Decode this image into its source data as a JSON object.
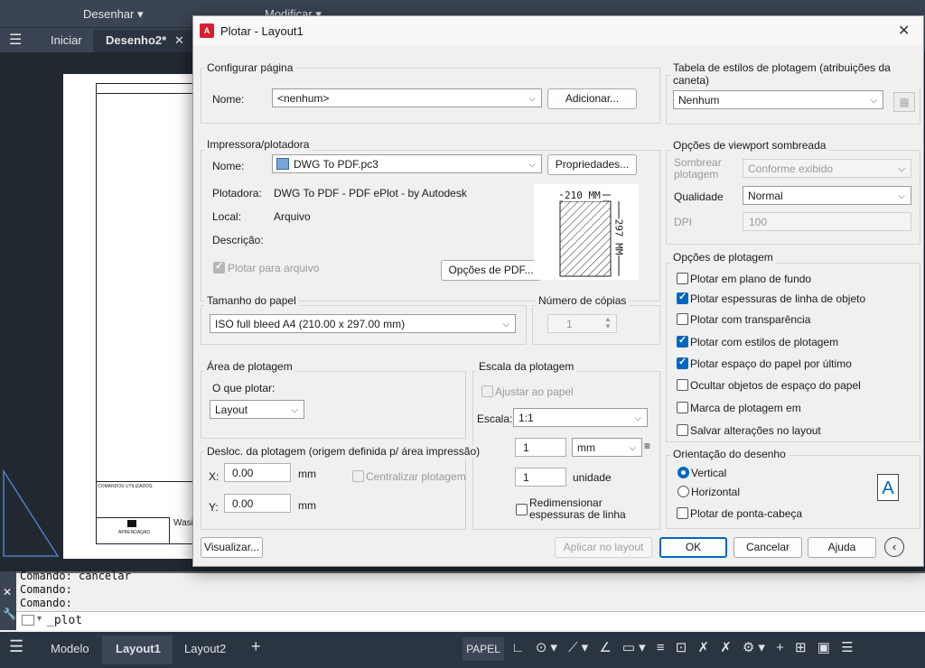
{
  "ribbon": {
    "desenhar": "Desenhar",
    "modificar": "Modificar"
  },
  "doc_tabs": {
    "iniciar": "Iniciar",
    "desenho2": "Desenho2*"
  },
  "dialog": {
    "title": "Plotar - Layout1",
    "page_setup": {
      "group": "Configurar página",
      "name_label": "Nome:",
      "name_value": "<nenhum>",
      "add_button": "Adicionar..."
    },
    "printer": {
      "group": "Impressora/plotadora",
      "name_label": "Nome:",
      "name_value": "DWG To PDF.pc3",
      "properties_button": "Propriedades...",
      "plotter_label": "Plotadora:",
      "plotter_value": "DWG To PDF - PDF ePlot - by Autodesk",
      "local_label": "Local:",
      "local_value": "Arquivo",
      "desc_label": "Descrição:",
      "plot_to_file": "Plotar para arquivo",
      "pdf_options_button": "Opções de PDF...",
      "preview_width": "210 MM",
      "preview_height": "297 MM"
    },
    "paper_size": {
      "group": "Tamanho do papel",
      "value": "ISO full bleed A4 (210.00 x 297.00 mm)"
    },
    "copies": {
      "group": "Número de cópias",
      "value": "1"
    },
    "plot_area": {
      "group": "Área de plotagem",
      "what_label": "O que plotar:",
      "what_value": "Layout"
    },
    "plot_scale": {
      "group": "Escala da plotagem",
      "fit": "Ajustar ao papel",
      "scale_label": "Escala:",
      "scale_value": "1:1",
      "mm_value": "1",
      "mm_unit": "mm",
      "unit_value": "1",
      "unit_label": "unidade",
      "lineweights": "Redimensionar espessuras de linha"
    },
    "offset": {
      "group": "Desloc. da plotagem (origem definida p/ área impressão)",
      "x_label": "X:",
      "x_value": "0.00",
      "x_unit": "mm",
      "y_label": "Y:",
      "y_value": "0.00",
      "y_unit": "mm",
      "center": "Centralizar plotagem"
    },
    "pen_table": {
      "group": "Tabela de estilos de plotagem (atribuições da caneta)",
      "value": "Nenhum"
    },
    "shaded": {
      "group": "Opções de viewport sombreada",
      "shade_label": "Sombrear plotagem",
      "shade_value": "Conforme exibido",
      "quality_label": "Qualidade",
      "quality_value": "Normal",
      "dpi_label": "DPI",
      "dpi_value": "100"
    },
    "plot_options": {
      "group": "Opções de plotagem",
      "items": [
        {
          "label": "Plotar em plano de fundo",
          "checked": false
        },
        {
          "label": "Plotar espessuras de linha de objeto",
          "checked": true
        },
        {
          "label": "Plotar com transparência",
          "checked": false
        },
        {
          "label": "Plotar com estilos de plotagem",
          "checked": true
        },
        {
          "label": "Plotar espaço do papel por último",
          "checked": true
        },
        {
          "label": "Ocultar objetos de espaço do papel",
          "checked": false
        },
        {
          "label": "Marca de plotagem em",
          "checked": false
        },
        {
          "label": "Salvar alterações no layout",
          "checked": false
        }
      ]
    },
    "orientation": {
      "group": "Orientação do desenho",
      "vertical": "Vertical",
      "horizontal": "Horizontal",
      "upside_down": "Plotar de ponta-cabeça"
    },
    "footer": {
      "preview": "Visualizar...",
      "apply": "Aplicar no layout",
      "ok": "OK",
      "cancel": "Cancelar",
      "help": "Ajuda"
    }
  },
  "command": {
    "line1": "Comando:  cancelar",
    "line2": "Comando:",
    "line3": "Comando:",
    "input": "_plot"
  },
  "status": {
    "modelo": "Modelo",
    "layout1": "Layout1",
    "layout2": "Layout2",
    "papel": "PAPEL"
  },
  "drawing": {
    "notes": "COMANDOS UTILIZADOS:",
    "logo_text": "APRENDAQAD",
    "wasi": "Wasi"
  }
}
